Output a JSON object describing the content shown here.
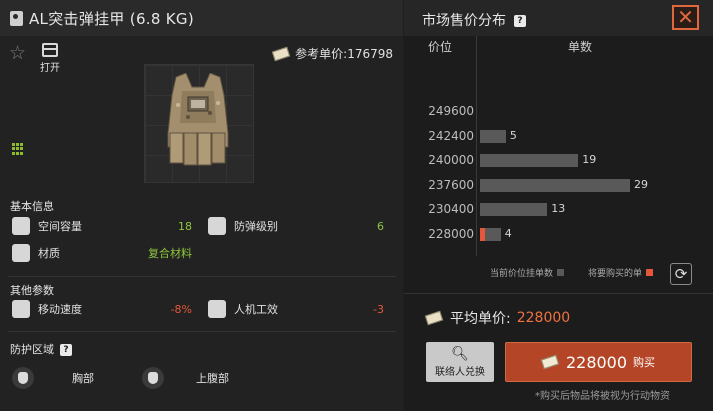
{
  "item": {
    "title": "AL突击弹挂甲 (6.8 KG)",
    "open_label": "打开",
    "ref_price_label": "参考单价:",
    "ref_price_value": "176798"
  },
  "basic_info": {
    "heading": "基本信息",
    "stats": [
      {
        "name": "空间容量",
        "value": "18",
        "icon": "backpack-icon"
      },
      {
        "name": "防弹级别",
        "value": "6",
        "icon": "shield-icon"
      },
      {
        "name": "材质",
        "value": "复合材料",
        "icon": "material-icon"
      }
    ]
  },
  "other_params": {
    "heading": "其他参数",
    "stats": [
      {
        "name": "移动速度",
        "value": "-8%",
        "icon": "running-icon"
      },
      {
        "name": "人机工效",
        "value": "-3",
        "icon": "pistol-icon"
      }
    ]
  },
  "protection": {
    "heading": "防护区域",
    "help": "?",
    "zones": [
      "胸部",
      "上腹部"
    ]
  },
  "market": {
    "title": "市场售价分布",
    "help": "?",
    "close": "✕",
    "col_price": "价位",
    "col_count": "单数",
    "legend_current": "当前价位挂单数",
    "legend_mine": "将要购买的单",
    "colors": {
      "current": "#595959",
      "mine": "#e4573a"
    }
  },
  "chart_data": {
    "type": "bar",
    "orientation": "horizontal",
    "categories": [
      "249600",
      "242400",
      "240000",
      "237600",
      "230400",
      "228000"
    ],
    "values": [
      0,
      5,
      19,
      29,
      13,
      4
    ],
    "labels": [
      "",
      "5",
      "19",
      "29",
      "13",
      "4"
    ],
    "to_buy": [
      0,
      0,
      0,
      0,
      0,
      1
    ],
    "xlabel": "单数",
    "ylabel": "价位"
  },
  "purchase": {
    "avg_label": "平均单价:",
    "avg_value": "228000",
    "exchange_label": "联络人兑换",
    "buy_price": "228000",
    "buy_label": "购买",
    "note": "*购买后物品将被视为行动物资"
  }
}
